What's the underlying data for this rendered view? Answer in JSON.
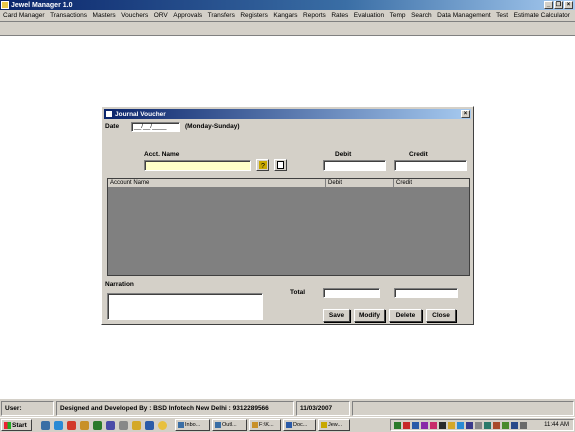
{
  "window": {
    "title": "Jewel Manager 1.0"
  },
  "menu": [
    "Card Manager",
    "Transactions",
    "Masters",
    "Vouchers",
    "ORV",
    "Approvals",
    "Transfers",
    "Registers",
    "Kangars",
    "Reports",
    "Rates",
    "Evaluation",
    "Temp",
    "Search",
    "Data Management",
    "Test",
    "Estimate Calculator"
  ],
  "dialog": {
    "title": "Journal Voucher",
    "date_label": "Date",
    "date_value": "__/__/____",
    "date_hint": "(Monday-Sunday)",
    "acct_name_label": "Acct. Name",
    "acct_name_value": "",
    "debit_label": "Debit",
    "credit_label": "Credit",
    "debit_value": "",
    "credit_value": "",
    "grid": {
      "columns": [
        "Account Name",
        "Debit",
        "Credit"
      ],
      "rows": []
    },
    "narration_label": "Narration",
    "narration_value": "",
    "total_label": "Total",
    "total_debit": "",
    "total_credit": "",
    "buttons": {
      "save": "Save",
      "modify": "Modify",
      "delete": "Delete",
      "close": "Close"
    }
  },
  "statusbar": {
    "user_label": "User:",
    "developer": "Designed and Developed By : BSD Infotech New Delhi : 9312289566",
    "date": "11/03/2007"
  },
  "taskbar": {
    "start_label": "Start",
    "tasks": [
      "Inbo...",
      "Outl...",
      "F:\\K...",
      "Doc...",
      "Jew..."
    ],
    "clock": "11:44 AM"
  },
  "colors": {
    "titlebar": "#0a246a",
    "face": "#d4d0c8",
    "grid_bg": "#808080",
    "acct_field": "#ffffc8"
  }
}
